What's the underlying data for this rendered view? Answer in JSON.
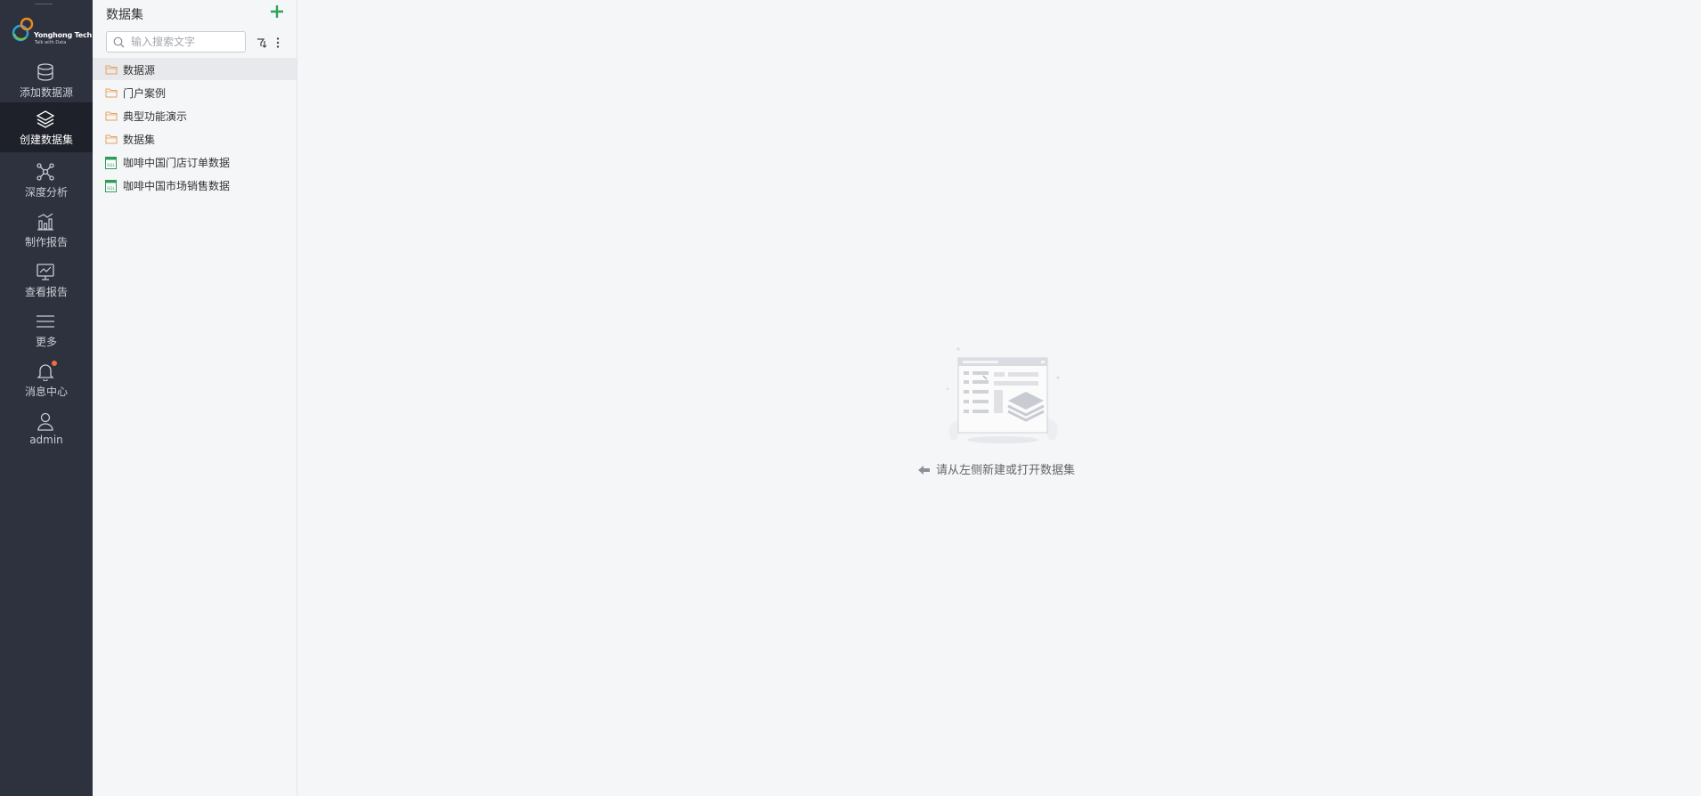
{
  "nav": {
    "logo": {
      "brand": "Yonghong Tech",
      "tagline": "Talk with Data"
    },
    "items": [
      {
        "label": "添加数据源",
        "icon": "database-icon"
      },
      {
        "label": "创建数据集",
        "icon": "layers-icon",
        "active": true
      },
      {
        "label": "深度分析",
        "icon": "network-icon"
      },
      {
        "label": "制作报告",
        "icon": "chart-icon"
      },
      {
        "label": "查看报告",
        "icon": "monitor-icon"
      },
      {
        "label": "更多",
        "icon": "menu-icon"
      },
      {
        "label": "消息中心",
        "icon": "bell-icon",
        "has_notification": true
      },
      {
        "label": "admin",
        "icon": "user-icon"
      }
    ]
  },
  "panel": {
    "title": "数据集",
    "search": {
      "placeholder": "输入搜索文字",
      "value": ""
    },
    "tree": [
      {
        "label": "数据源",
        "type": "folder",
        "selected": true
      },
      {
        "label": "门户案例",
        "type": "folder"
      },
      {
        "label": "典型功能演示",
        "type": "folder"
      },
      {
        "label": "数据集",
        "type": "folder"
      },
      {
        "label": "咖啡中国门店订单数据",
        "type": "sql-dataset"
      },
      {
        "label": "咖啡中国市场销售数据",
        "type": "sql-dataset"
      }
    ]
  },
  "main": {
    "empty_hint": "请从左侧新建或打开数据集"
  },
  "colors": {
    "nav_bg": "#2e323e",
    "nav_active_bg": "#1e212a",
    "accent_green": "#2fa35a",
    "folder_orange": "#e8a25a",
    "notification_dot": "#ef6f3c"
  }
}
